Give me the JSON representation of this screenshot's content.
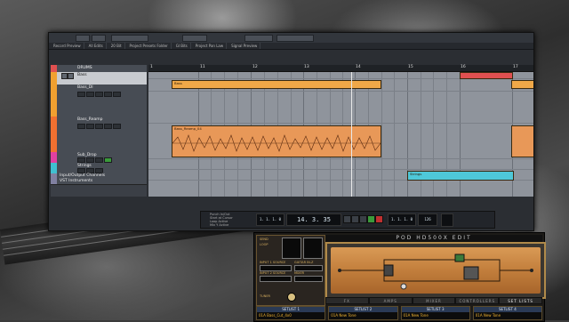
{
  "toolbar": {
    "menus": [
      "Record Preview",
      "All Edits",
      "20 Bit",
      "Project Presets Folder",
      "GI Bits",
      "Project Pan Law",
      "Signal Preview"
    ]
  },
  "tracks": [
    {
      "name": "DRUMS",
      "color": "#e05050"
    },
    {
      "name": "Bass",
      "color": "#f0a030"
    },
    {
      "name": "Bass_DI",
      "color": "#f0a030"
    },
    {
      "name": "Bass_Reamp",
      "color": "#f07030"
    },
    {
      "name": "Sub_Drop",
      "color": "#e040a0"
    },
    {
      "name": "Strings",
      "color": "#40c0d0"
    },
    {
      "name": "Input/Output Channels",
      "color": "#8080a0"
    },
    {
      "name": "VST Instruments",
      "color": "#8080a0"
    }
  ],
  "ruler": {
    "bars": [
      "1",
      "11",
      "12",
      "13",
      "14",
      "15",
      "16",
      "17"
    ]
  },
  "clips": {
    "bass_di": "Bass",
    "bass_reamp": "Bass_Reamp_04",
    "strings": "Strings",
    "drums": "Drums"
  },
  "transport": {
    "position": "14. 3. 35",
    "tempo_label": "126",
    "left_locator": "1. 1. 1. 0",
    "right_locator": "1. 1. 1. 0",
    "labels": [
      "Punch In/Out",
      "Start at Cursor",
      "Loop Active",
      "Mix Y Active"
    ]
  },
  "pod": {
    "title": "POD HD500X EDIT",
    "left_labels": [
      "SEND",
      "LOOP",
      "INPUT 1 SOURCE",
      "INPUT 2 SOURCE",
      "GUITAR IN-Z",
      "MIXER",
      "TUNER"
    ],
    "tabs": [
      "FX",
      "AMPS",
      "MIXER",
      "CONTROLLERS",
      "SET LISTS"
    ],
    "setlists": [
      {
        "header": "SETLIST 1",
        "value": "01A Bass_Cut_4x0"
      },
      {
        "header": "SETLIST 2",
        "value": "01A New Tone"
      },
      {
        "header": "SETLIST 3",
        "value": "01A New Tone"
      },
      {
        "header": "SETLIST 4",
        "value": "01A New Tone"
      }
    ]
  },
  "colors": {
    "accent": "#f0a030",
    "reamp": "#f07030",
    "strings": "#40c0d0",
    "drums": "#e05050"
  }
}
